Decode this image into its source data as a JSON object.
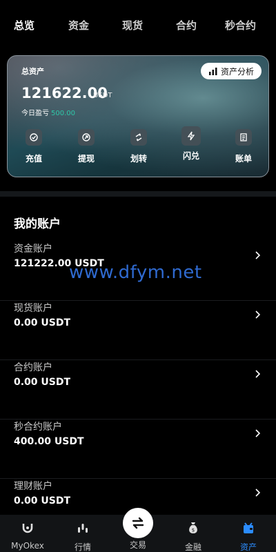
{
  "tabs": [
    {
      "label": "总览",
      "active": true
    },
    {
      "label": "资金",
      "active": false
    },
    {
      "label": "现货",
      "active": false
    },
    {
      "label": "合约",
      "active": false
    },
    {
      "label": "秒合约",
      "active": false
    }
  ],
  "card": {
    "label": "总资产",
    "analysis_label": "资产分析",
    "total": "121622.00",
    "unit": "USDT",
    "pnl_label": "今日盈亏",
    "pnl_value": "500.00",
    "actions": [
      {
        "label": "充值",
        "icon": "deposit-icon"
      },
      {
        "label": "提现",
        "icon": "withdraw-icon"
      },
      {
        "label": "划转",
        "icon": "transfer-icon"
      },
      {
        "label": "闪兑",
        "icon": "flash-icon"
      },
      {
        "label": "账单",
        "icon": "bill-icon"
      }
    ]
  },
  "accounts_section": {
    "title": "我的账户",
    "items": [
      {
        "name": "资金账户",
        "balance": "121222.00 USDT"
      },
      {
        "name": "现货账户",
        "balance": "0.00 USDT"
      },
      {
        "name": "合约账户",
        "balance": "0.00 USDT"
      },
      {
        "name": "秒合约账户",
        "balance": "400.00 USDT"
      },
      {
        "name": "理财账户",
        "balance": "0.00 USDT"
      }
    ]
  },
  "watermark": "www.dfym.net",
  "bottom_nav": [
    {
      "label": "MyOkex",
      "icon": "magnet-icon",
      "active": false
    },
    {
      "label": "行情",
      "icon": "market-icon",
      "active": false
    },
    {
      "label": "交易",
      "icon": "swap-icon",
      "active": false
    },
    {
      "label": "金融",
      "icon": "money-bag-icon",
      "active": false
    },
    {
      "label": "资产",
      "icon": "wallet-icon",
      "active": true
    }
  ],
  "colors": {
    "accent": "#2b8cff",
    "profit": "#2ec7a8",
    "background": "#000000"
  }
}
